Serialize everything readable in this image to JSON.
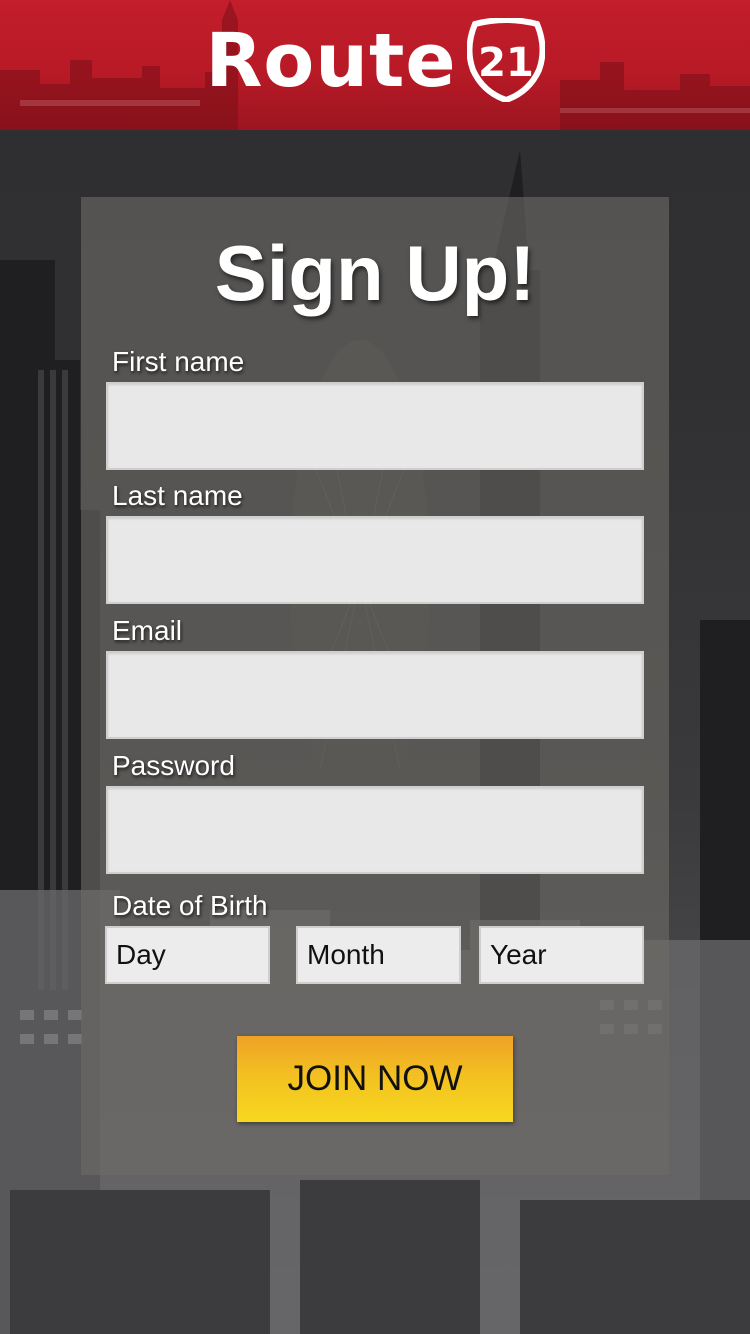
{
  "header": {
    "logo_text": "Route",
    "logo_number": "21",
    "brand_color": "#c21e2b"
  },
  "form": {
    "title": "Sign Up!",
    "fields": {
      "first_name": {
        "label": "First name",
        "value": ""
      },
      "last_name": {
        "label": "Last name",
        "value": ""
      },
      "email": {
        "label": "Email",
        "value": ""
      },
      "password": {
        "label": "Password",
        "value": ""
      }
    },
    "dob": {
      "label": "Date of Birth",
      "day": "Day",
      "month": "Month",
      "year": "Year"
    },
    "submit_label": "JOIN NOW",
    "submit_color": "#f3c021"
  }
}
